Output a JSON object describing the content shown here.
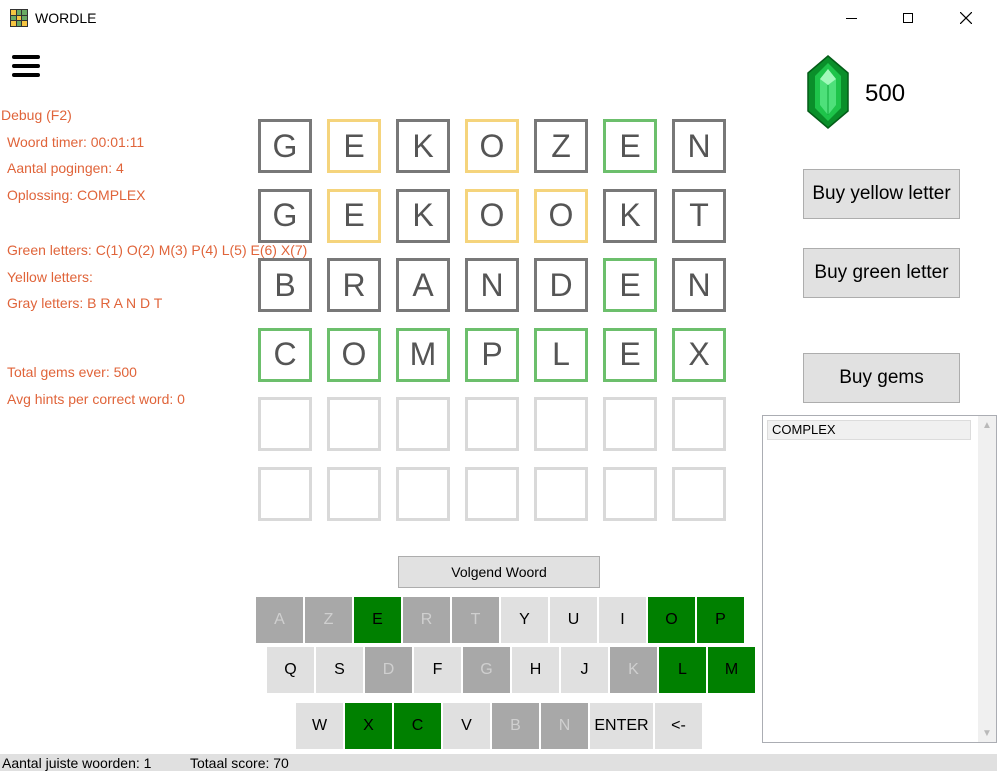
{
  "window": {
    "title": "WORDLE"
  },
  "debug": {
    "header": "Debug (F2)",
    "timer": "Woord timer: 00:01:11",
    "attempts": "Aantal pogingen: 4",
    "solution": "Oplossing: COMPLEX",
    "green": "Green letters: C(1) O(2) M(3) P(4) L(5) E(6) X(7)",
    "yellow": "Yellow letters:",
    "gray": "Gray letters: B R A N D T",
    "total_gems": "Total gems ever: 500",
    "avg_hints": "Avg hints per correct word: 0"
  },
  "gems": {
    "count": "500",
    "icon": "emerald-gem-icon"
  },
  "buttons": {
    "buy_yellow": "Buy yellow letter",
    "buy_green": "Buy green letter",
    "buy_gems": "Buy gems",
    "next_word": "Volgend Woord"
  },
  "word_list": [
    "COMPLEX"
  ],
  "board": [
    [
      [
        "G",
        "gray"
      ],
      [
        "E",
        "yellow"
      ],
      [
        "K",
        "gray"
      ],
      [
        "O",
        "yellow"
      ],
      [
        "Z",
        "gray"
      ],
      [
        "E",
        "green"
      ],
      [
        "N",
        "gray"
      ]
    ],
    [
      [
        "G",
        "gray"
      ],
      [
        "E",
        "yellow"
      ],
      [
        "K",
        "gray"
      ],
      [
        "O",
        "yellow"
      ],
      [
        "O",
        "yellow"
      ],
      [
        "K",
        "gray"
      ],
      [
        "T",
        "gray"
      ]
    ],
    [
      [
        "B",
        "gray"
      ],
      [
        "R",
        "gray"
      ],
      [
        "A",
        "gray"
      ],
      [
        "N",
        "gray"
      ],
      [
        "D",
        "gray"
      ],
      [
        "E",
        "green"
      ],
      [
        "N",
        "gray"
      ]
    ],
    [
      [
        "C",
        "green"
      ],
      [
        "O",
        "green"
      ],
      [
        "M",
        "green"
      ],
      [
        "P",
        "green"
      ],
      [
        "L",
        "green"
      ],
      [
        "E",
        "green"
      ],
      [
        "X",
        "green"
      ]
    ],
    [
      [
        "",
        "empty"
      ],
      [
        "",
        "empty"
      ],
      [
        "",
        "empty"
      ],
      [
        "",
        "empty"
      ],
      [
        "",
        "empty"
      ],
      [
        "",
        "empty"
      ],
      [
        "",
        "empty"
      ]
    ],
    [
      [
        "",
        "empty"
      ],
      [
        "",
        "empty"
      ],
      [
        "",
        "empty"
      ],
      [
        "",
        "empty"
      ],
      [
        "",
        "empty"
      ],
      [
        "",
        "empty"
      ],
      [
        "",
        "empty"
      ]
    ]
  ],
  "keyboard": [
    [
      [
        "A",
        "used"
      ],
      [
        "Z",
        "used"
      ],
      [
        "E",
        "green"
      ],
      [
        "R",
        "used"
      ],
      [
        "T",
        "used"
      ],
      [
        "Y",
        "light"
      ],
      [
        "U",
        "light"
      ],
      [
        "I",
        "light"
      ],
      [
        "O",
        "green"
      ],
      [
        "P",
        "green"
      ]
    ],
    [
      [
        "Q",
        "light"
      ],
      [
        "S",
        "light"
      ],
      [
        "D",
        "used"
      ],
      [
        "F",
        "light"
      ],
      [
        "G",
        "used"
      ],
      [
        "H",
        "light"
      ],
      [
        "J",
        "light"
      ],
      [
        "K",
        "used"
      ],
      [
        "L",
        "green"
      ],
      [
        "M",
        "green"
      ]
    ],
    [
      [
        "W",
        "light"
      ],
      [
        "X",
        "green"
      ],
      [
        "C",
        "green"
      ],
      [
        "V",
        "light"
      ],
      [
        "B",
        "used"
      ],
      [
        "N",
        "used"
      ],
      [
        "ENTER",
        "light"
      ],
      [
        "<-",
        "light"
      ]
    ]
  ],
  "status": {
    "correct_words": "Aantal juiste woorden: 1",
    "total_score": "Totaal score: 70"
  },
  "colors": {
    "debug_text": "#e0643a",
    "green_key": "#008000",
    "used_key": "#a8a8a8"
  }
}
